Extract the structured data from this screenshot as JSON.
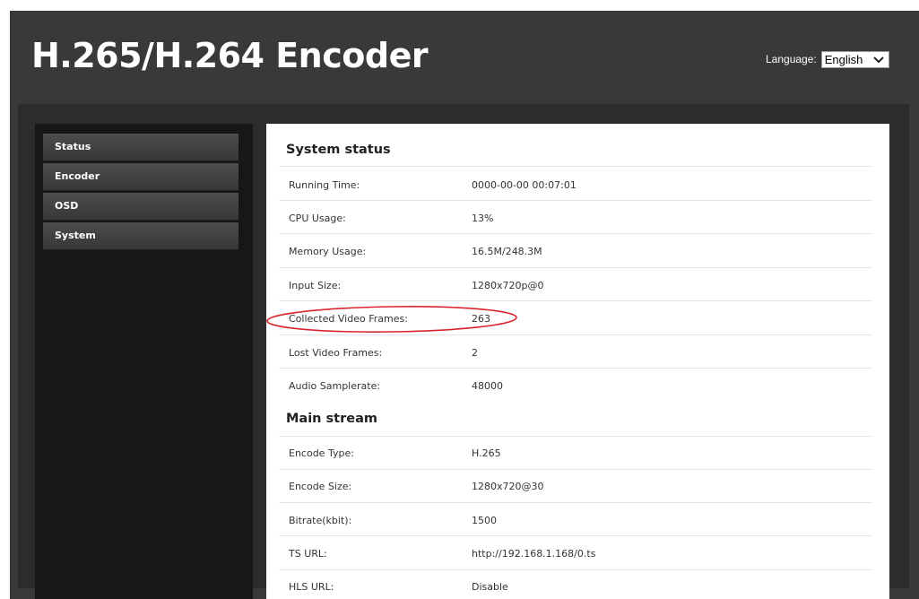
{
  "header": {
    "title": "H.265/H.264 Encoder",
    "language_label": "Language:",
    "language_value": "English"
  },
  "sidebar": {
    "items": [
      {
        "label": "Status"
      },
      {
        "label": "Encoder"
      },
      {
        "label": "OSD"
      },
      {
        "label": "System"
      }
    ]
  },
  "system_status": {
    "title": "System status",
    "rows": [
      {
        "label": "Running Time:",
        "value": "0000-00-00 00:07:01"
      },
      {
        "label": "CPU Usage:",
        "value": "13%"
      },
      {
        "label": "Memory Usage:",
        "value": "16.5M/248.3M"
      },
      {
        "label": "Input Size:",
        "value": "1280x720p@0"
      },
      {
        "label": "Collected Video Frames:",
        "value": "263"
      },
      {
        "label": "Lost Video Frames:",
        "value": "2"
      },
      {
        "label": "Audio Samplerate:",
        "value": "48000"
      }
    ]
  },
  "main_stream": {
    "title": "Main stream",
    "rows": [
      {
        "label": "Encode Type:",
        "value": "H.265"
      },
      {
        "label": "Encode Size:",
        "value": "1280x720@30"
      },
      {
        "label": "Bitrate(kbit):",
        "value": "1500"
      },
      {
        "label": "TS URL:",
        "value": "http://192.168.1.168/0.ts"
      },
      {
        "label": "HLS URL:",
        "value": "Disable"
      }
    ]
  },
  "colors": {
    "header_bg": "#37393a",
    "sidebar_bg": "#151718",
    "annotation": "#d9262c"
  }
}
